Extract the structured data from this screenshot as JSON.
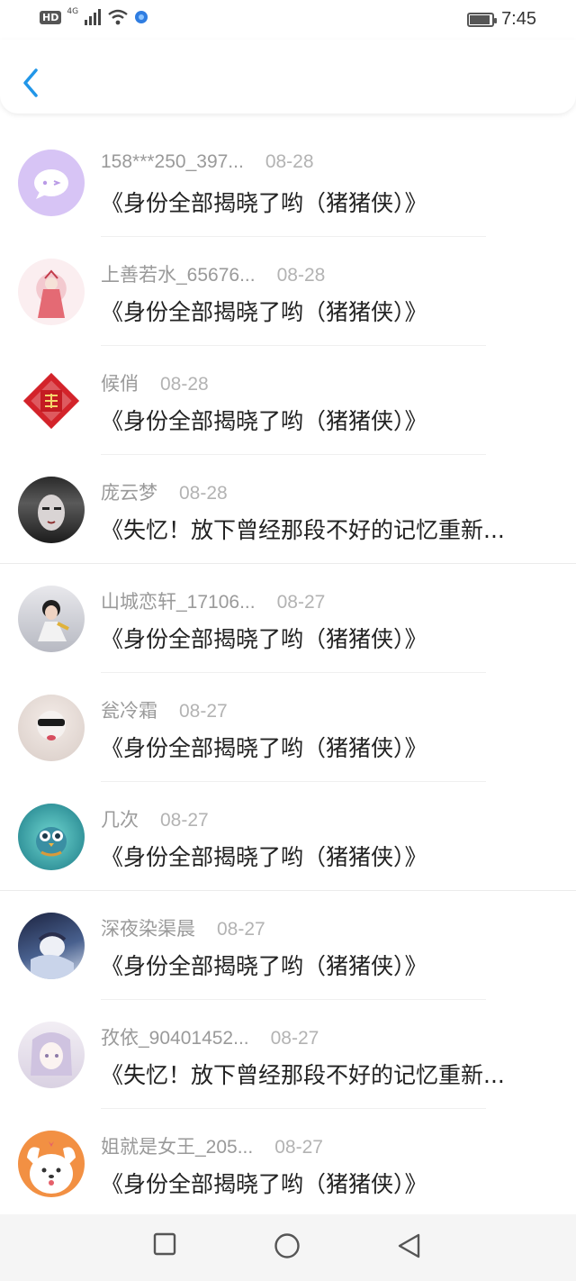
{
  "status_bar": {
    "hd_label": "HD",
    "network_label": "4G",
    "time": "7:45"
  },
  "header": {
    "back_icon": "chevron-left-icon",
    "accent_color": "#2196e8"
  },
  "items": [
    {
      "user": "158***250_397...",
      "date": "08-28",
      "title": "《身份全部揭晓了哟（猪猪侠）》",
      "avatar": "chat-bubble-icon"
    },
    {
      "user": "上善若水_65676...",
      "date": "08-28",
      "title": "《身份全部揭晓了哟（猪猪侠）》",
      "avatar": "photo"
    },
    {
      "user": "候俏",
      "date": "08-28",
      "title": "《身份全部揭晓了哟（猪猪侠）》",
      "avatar": "fu-charm"
    },
    {
      "user": "庞云梦",
      "date": "08-28",
      "title": "《失忆！放下曾经那段不好的记忆重新...",
      "avatar": "photo"
    },
    {
      "user": "山城恋轩_17106...",
      "date": "08-27",
      "title": "《身份全部揭晓了哟（猪猪侠）》",
      "avatar": "photo"
    },
    {
      "user": "瓮冷霜",
      "date": "08-27",
      "title": "《身份全部揭晓了哟（猪猪侠）》",
      "avatar": "photo"
    },
    {
      "user": "几次",
      "date": "08-27",
      "title": "《身份全部揭晓了哟（猪猪侠）》",
      "avatar": "owl-illustration"
    },
    {
      "user": "深夜染渠晨",
      "date": "08-27",
      "title": "《身份全部揭晓了哟（猪猪侠）》",
      "avatar": "photo"
    },
    {
      "user": "孜依_90401452...",
      "date": "08-27",
      "title": "《失忆！放下曾经那段不好的记忆重新...",
      "avatar": "photo"
    },
    {
      "user": "姐就是女王_205...",
      "date": "08-27",
      "title": "《身份全部揭晓了哟（猪猪侠）》",
      "avatar": "cartoon-dog"
    }
  ],
  "nav_bar": {
    "recent_icon": "square-icon",
    "home_icon": "circle-icon",
    "back_icon": "triangle-back-icon"
  }
}
